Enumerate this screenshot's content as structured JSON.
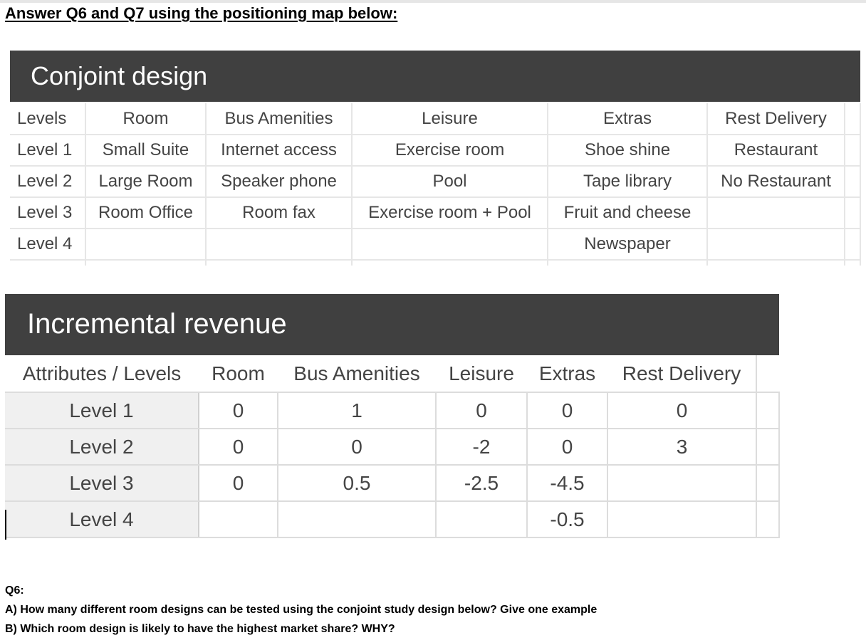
{
  "heading": "Answer Q6 and Q7 using the positioning map below:",
  "conjoint": {
    "title": "Conjoint design",
    "headers": [
      "Levels",
      "Room",
      "Bus Amenities",
      "Leisure",
      "Extras",
      "Rest Delivery"
    ],
    "rows": [
      [
        "Level 1",
        "Small Suite",
        "Internet access",
        "Exercise room",
        "Shoe shine",
        "Restaurant"
      ],
      [
        "Level 2",
        "Large Room",
        "Speaker phone",
        "Pool",
        "Tape library",
        "No Restaurant"
      ],
      [
        "Level 3",
        "Room Office",
        "Room fax",
        "Exercise room + Pool",
        "Fruit and cheese",
        ""
      ],
      [
        "Level 4",
        "",
        "",
        "",
        "Newspaper",
        ""
      ]
    ]
  },
  "revenue": {
    "title": "Incremental revenue",
    "headers": [
      "Attributes / Levels",
      "Room",
      "Bus Amenities",
      "Leisure",
      "Extras",
      "Rest Delivery"
    ],
    "rows": [
      [
        "Level 1",
        "0",
        "1",
        "0",
        "0",
        "0"
      ],
      [
        "Level 2",
        "0",
        "0",
        "-2",
        "0",
        "3"
      ],
      [
        "Level 3",
        "0",
        "0.5",
        "-2.5",
        "-4.5",
        ""
      ],
      [
        "Level 4",
        "",
        "",
        "",
        "-0.5",
        ""
      ]
    ]
  },
  "questions": {
    "label": "Q6:",
    "a": "A) How many different room designs can be tested using the conjoint study design below? Give one example",
    "b": "B) Which room design is likely to have the highest market share? WHY?"
  }
}
